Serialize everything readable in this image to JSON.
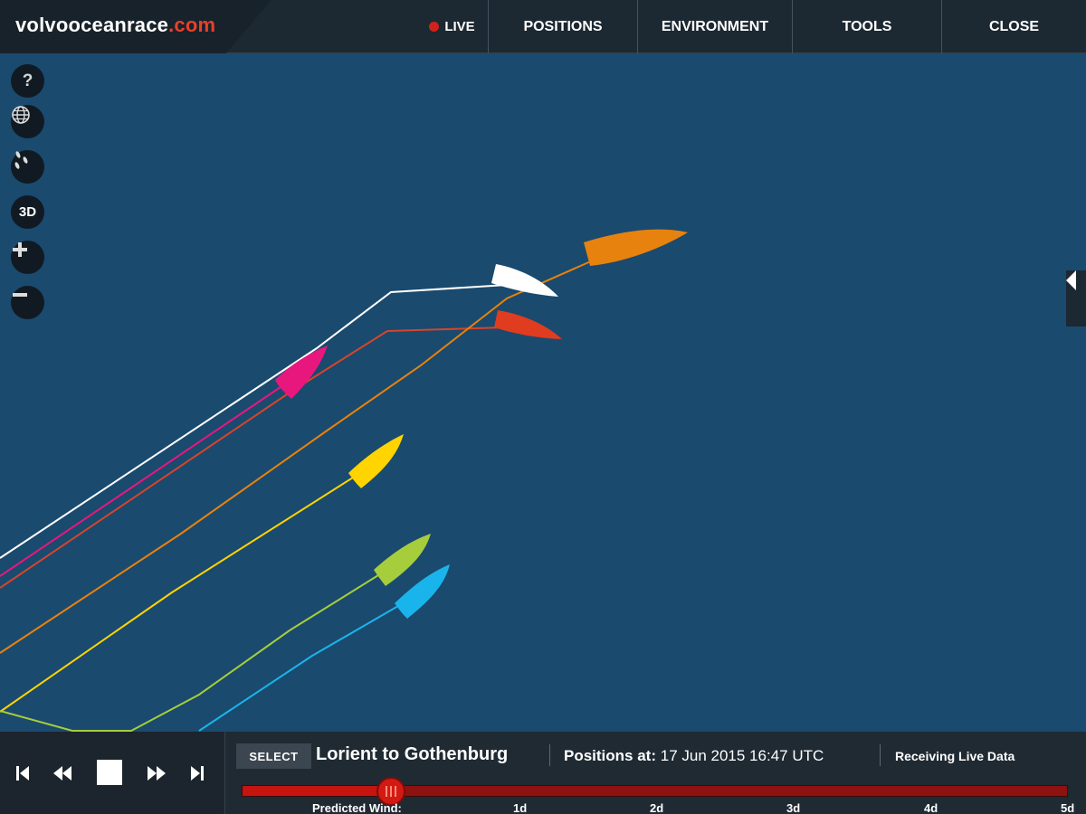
{
  "header": {
    "logo_main": "volvooceanrace",
    "logo_accent": ".com",
    "live_label": "LIVE",
    "nav": [
      {
        "label": "POSITIONS"
      },
      {
        "label": "ENVIRONMENT"
      },
      {
        "label": "TOOLS"
      },
      {
        "label": "CLOSE"
      }
    ]
  },
  "map_tools": {
    "help": "?",
    "three_d": "3D"
  },
  "boats": [
    {
      "color": "#e8820e"
    },
    {
      "color": "#ffffff"
    },
    {
      "color": "#e03c1f"
    },
    {
      "color": "#e8177e"
    },
    {
      "color": "#ffd400"
    },
    {
      "color": "#a6cd3c"
    },
    {
      "color": "#1ab4ec"
    }
  ],
  "bottom": {
    "select_label": "SELECT",
    "leg_title": "Lorient to Gothenburg",
    "positions_label": "Positions at:",
    "positions_time": "17 Jun 2015 16:47 UTC",
    "status": "Receiving Live Data",
    "timeline": {
      "predicted_label": "Predicted Wind:",
      "ticks": [
        "1d",
        "2d",
        "3d",
        "4d",
        "5d"
      ],
      "progress": 0.18
    }
  },
  "colors": {
    "sea": "#1a4a6e",
    "bar": "#1c2832",
    "accent": "#e8402a",
    "live": "#d0221a"
  }
}
